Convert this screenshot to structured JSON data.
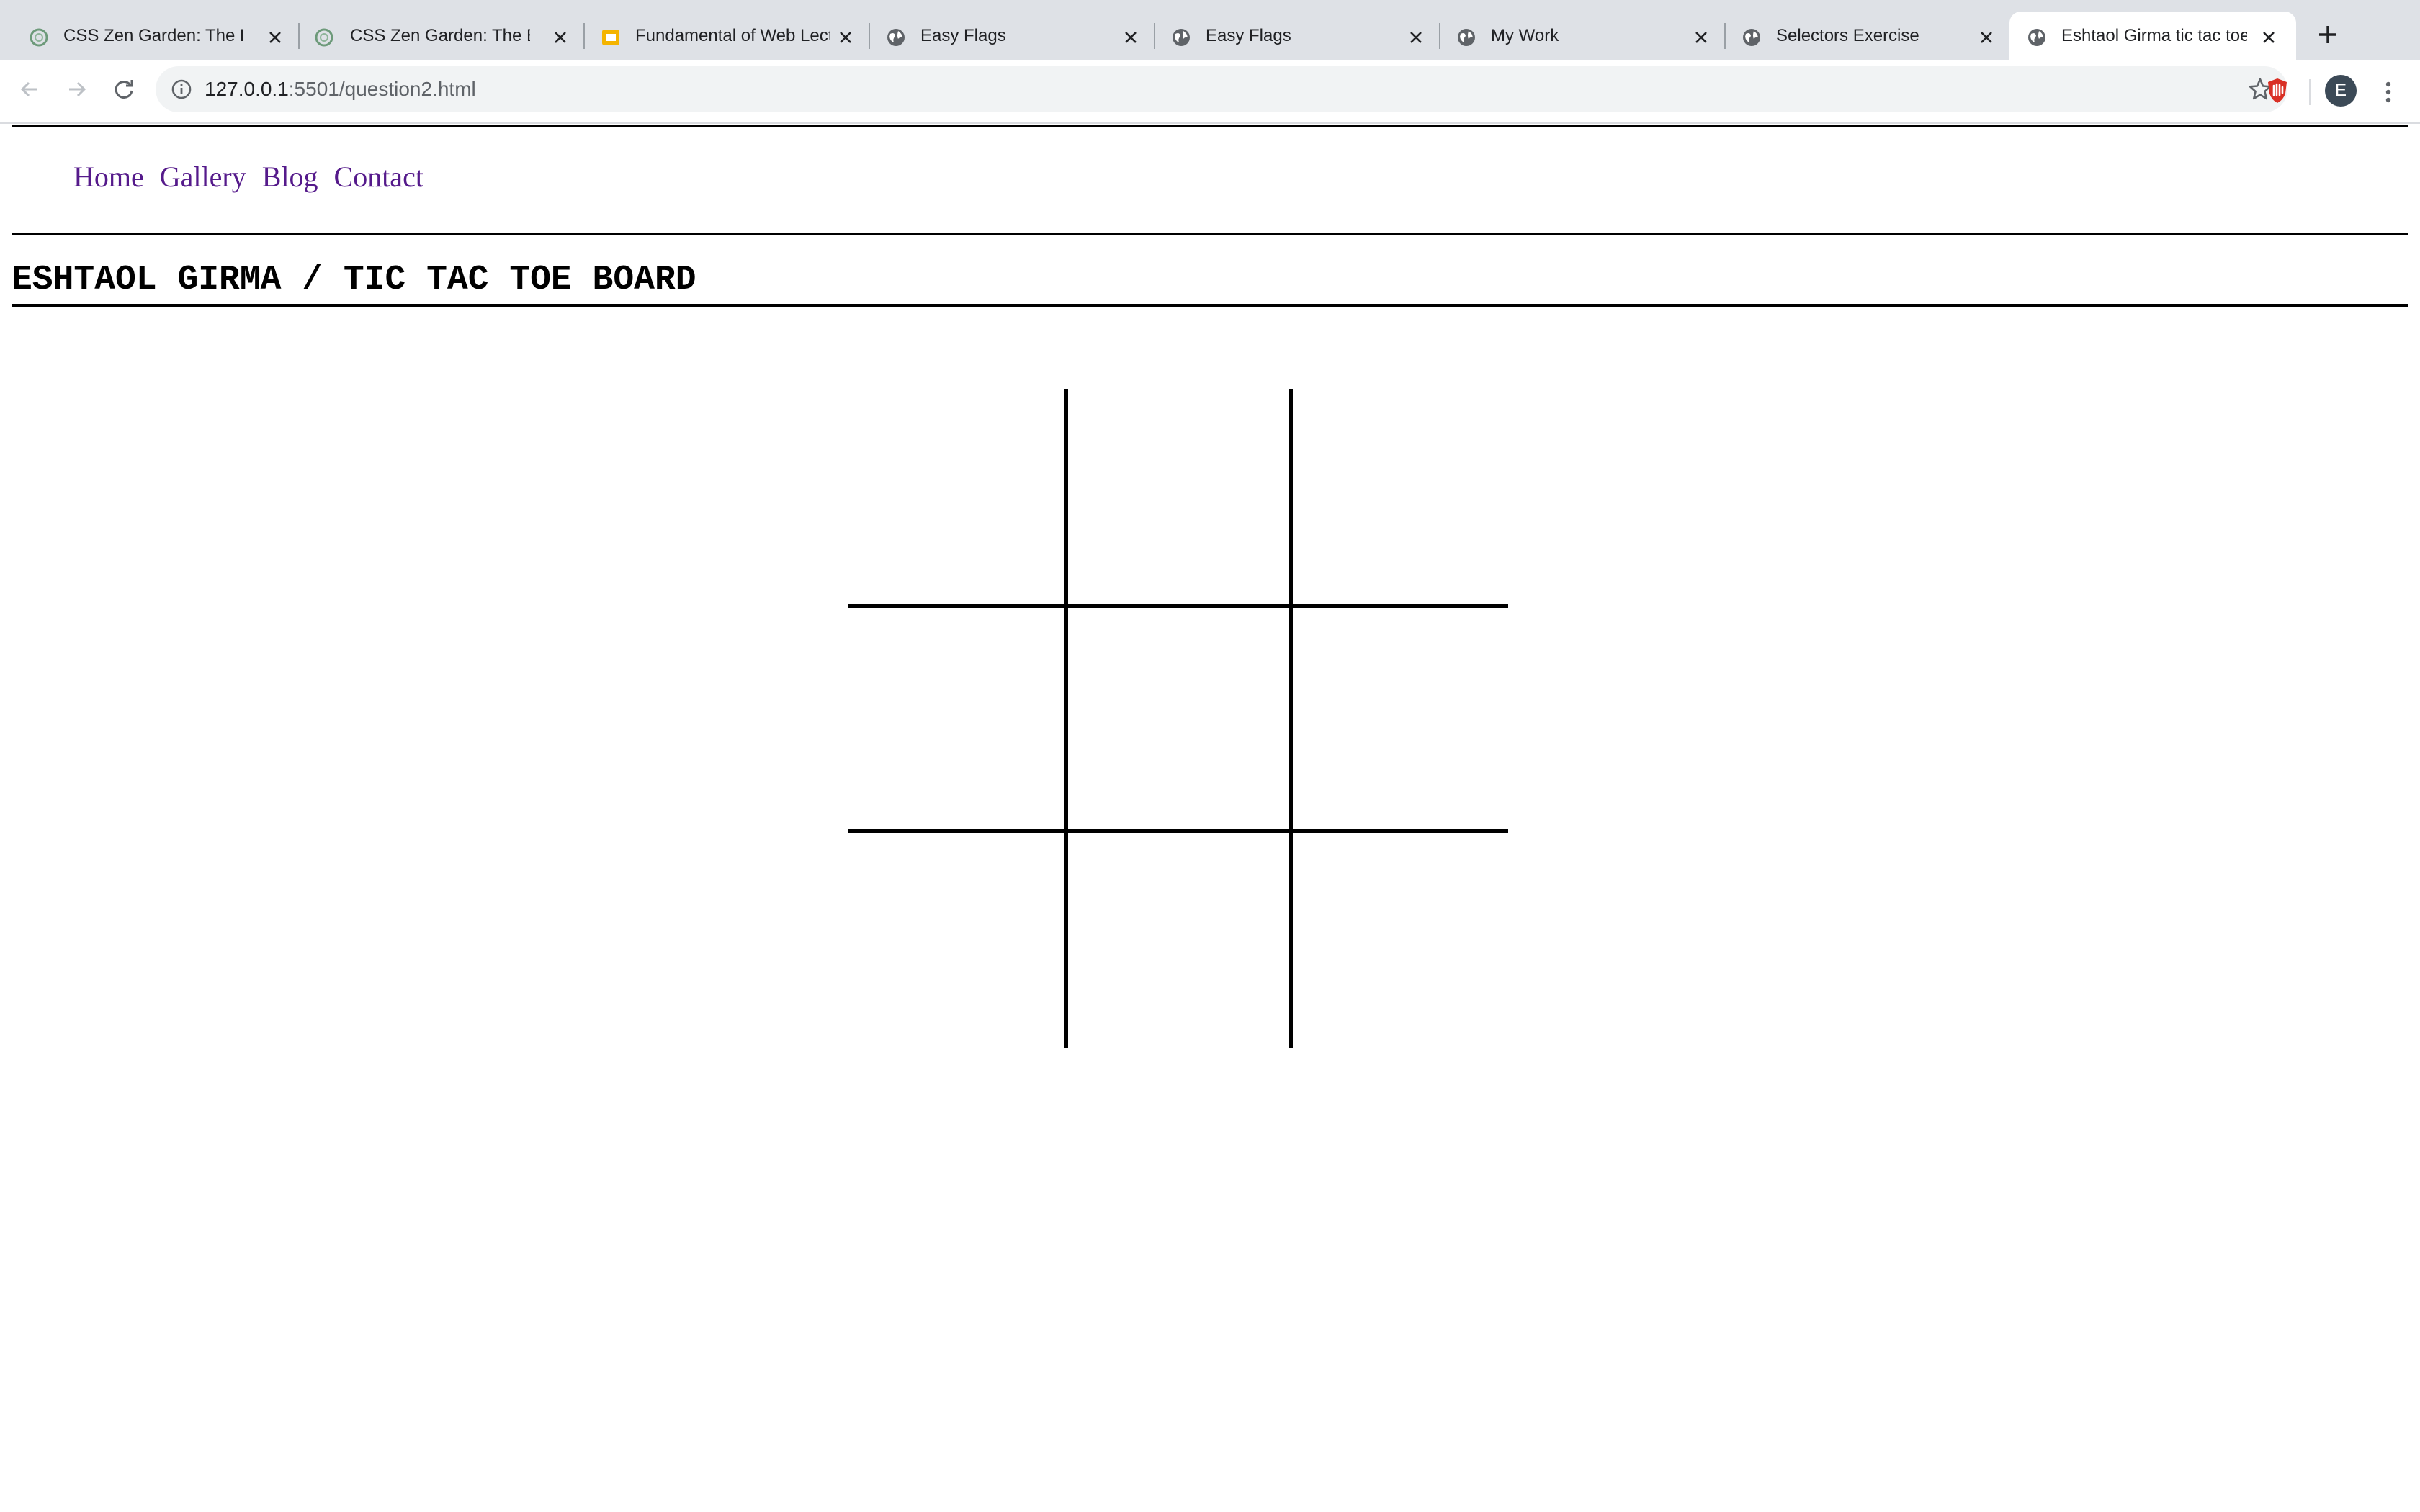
{
  "browser": {
    "tabs": [
      {
        "title": "CSS Zen Garden: The Beauty of CSS Design",
        "favicon": "zen-garden-icon",
        "active": false
      },
      {
        "title": "CSS Zen Garden: The Beauty of CSS Design",
        "favicon": "zen-garden-icon",
        "active": false
      },
      {
        "title": "Fundamental of Web Lecture",
        "favicon": "slides-icon",
        "active": false
      },
      {
        "title": "Easy Flags",
        "favicon": "globe-icon",
        "active": false
      },
      {
        "title": "Easy Flags",
        "favicon": "globe-icon",
        "active": false
      },
      {
        "title": "My Work",
        "favicon": "globe-icon",
        "active": false
      },
      {
        "title": "Selectors Exercise",
        "favicon": "globe-icon",
        "active": false
      },
      {
        "title": "Eshtaol Girma tic tac toe board",
        "favicon": "globe-icon",
        "active": true
      }
    ],
    "url": {
      "host": "127.0.0.1",
      "path": ":5501/question2.html"
    },
    "profile_initial": "E",
    "accent_colors": {
      "tabstrip": "#dee1e6",
      "omnibox": "#f1f3f4",
      "extension_red": "#d93025",
      "slides_yellow": "#f4b400"
    }
  },
  "page": {
    "nav": {
      "links": [
        "Home",
        "Gallery",
        "Blog",
        "Contact"
      ],
      "link_color": "#551a8b"
    },
    "heading": "Eshtaol Girma / Tic Tac Toe Board",
    "board": {
      "cells": [
        "",
        "",
        "",
        "",
        "",
        "",
        "",
        "",
        ""
      ]
    }
  }
}
